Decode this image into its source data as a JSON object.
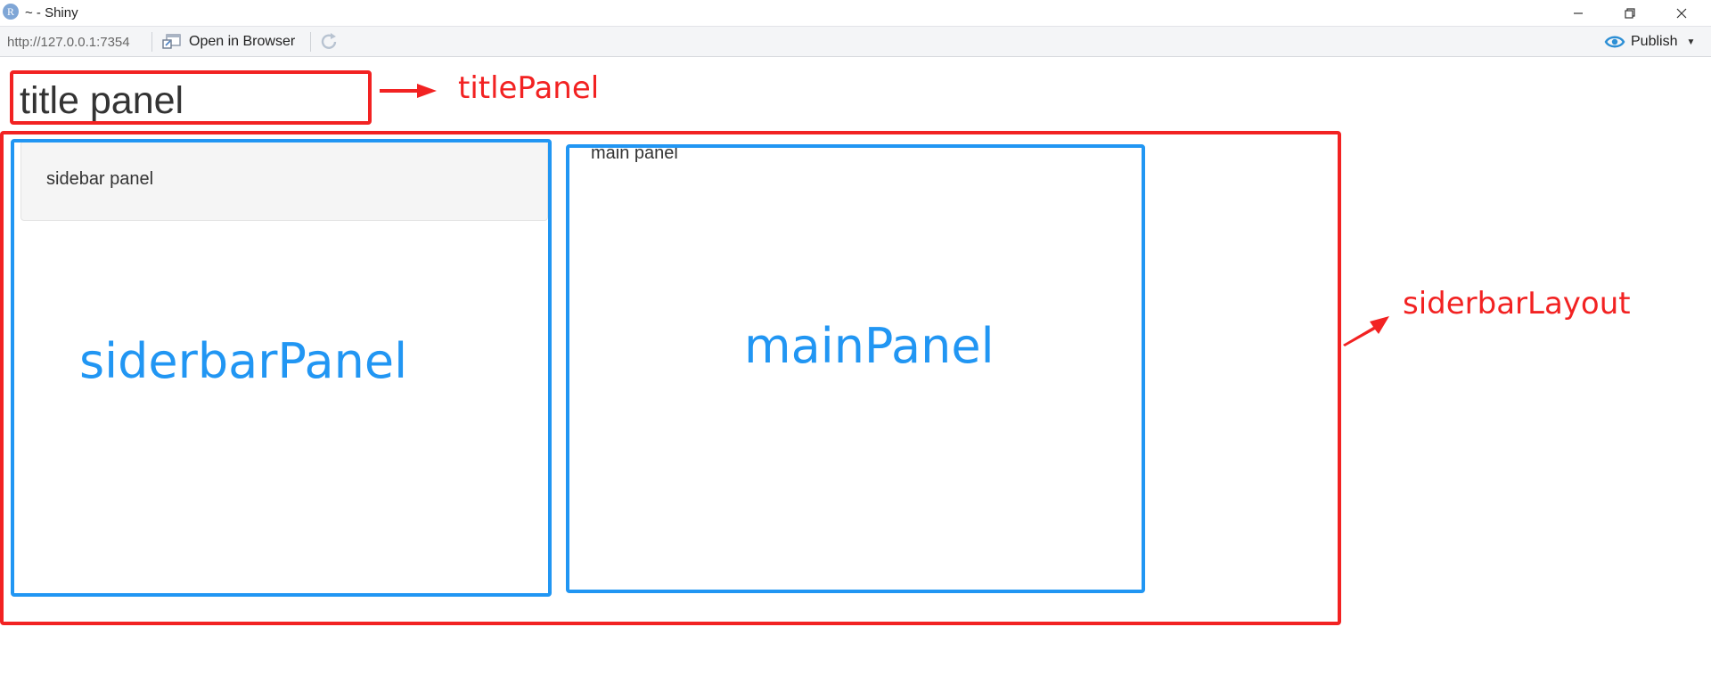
{
  "window": {
    "title": "~ - Shiny",
    "app_icon_letter": "R",
    "controls": {
      "minimize": "—",
      "maximize": "❐",
      "close": "✕"
    }
  },
  "toolbar": {
    "url": "http://127.0.0.1:7354",
    "open_in_browser_label": "Open in Browser",
    "publish_label": "Publish",
    "publish_caret": "▼"
  },
  "app": {
    "title_panel_text": "title panel",
    "sidebar_panel_text": "sidebar panel",
    "main_panel_text": "main panel"
  },
  "annotations": {
    "title_panel_label": "titlePanel",
    "sidebar_layout_label": "siderbarLayout",
    "sidebar_panel_label": "siderbarPanel",
    "main_panel_label": "mainPanel",
    "colors": {
      "red": "#f22222",
      "blue": "#2196f3"
    }
  }
}
